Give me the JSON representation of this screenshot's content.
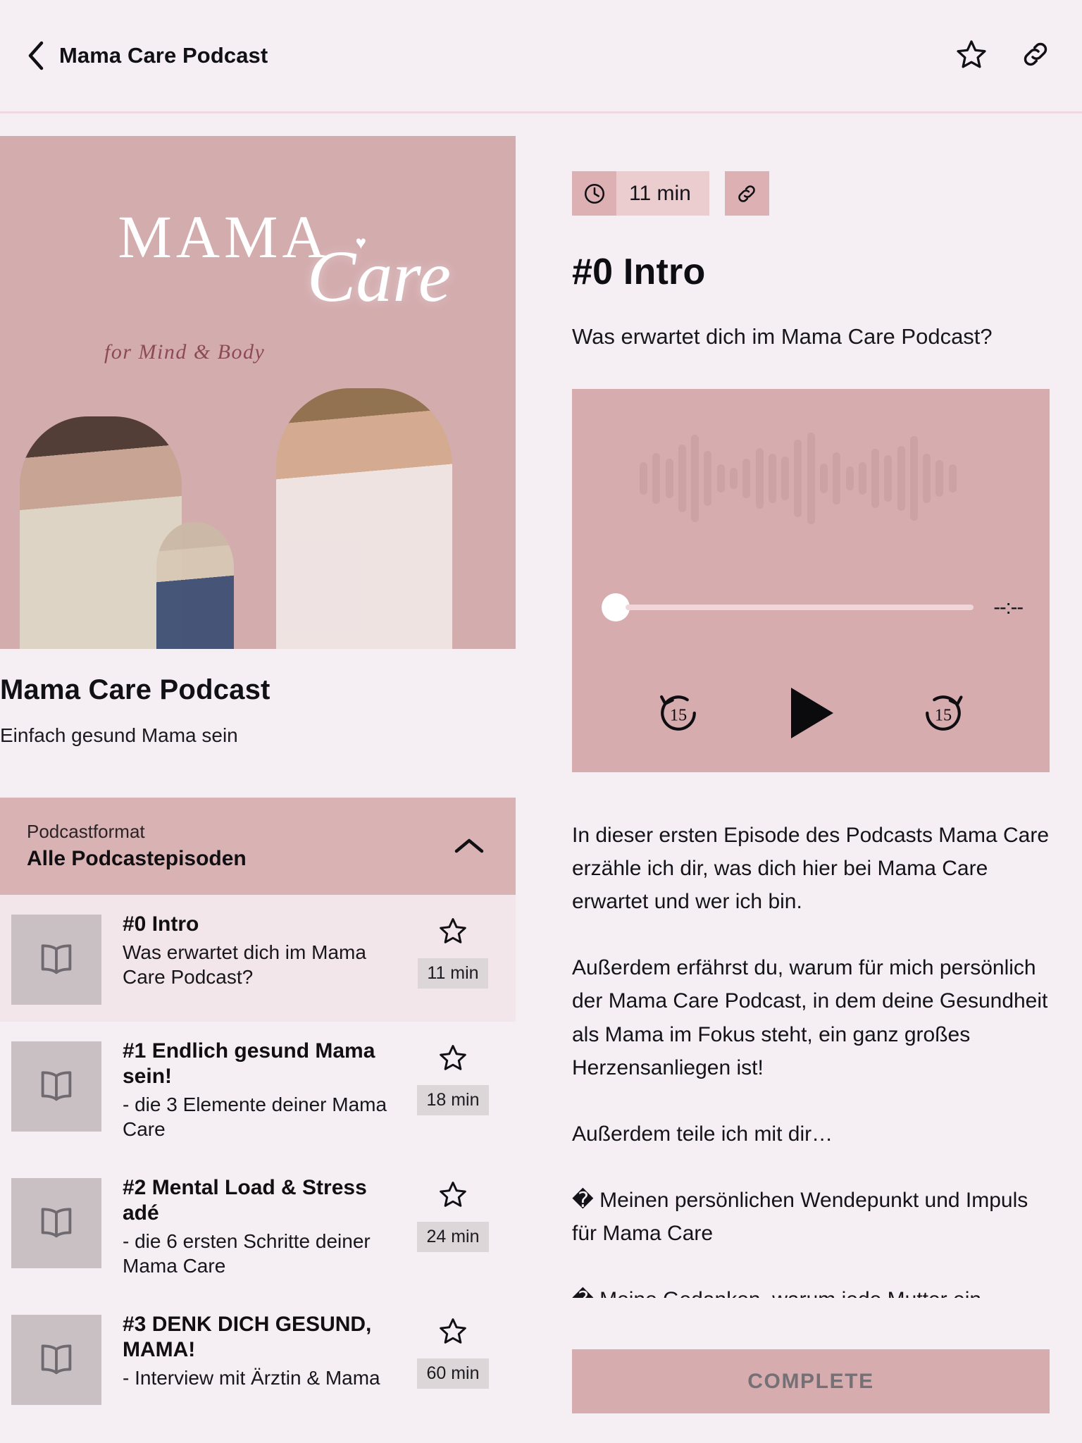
{
  "header": {
    "title": "Mama Care Podcast",
    "back_icon": "chevron-left-icon",
    "favorite_icon": "star-outline-icon",
    "share_icon": "link-icon"
  },
  "cover": {
    "brand_main": "MAMA",
    "brand_script": "Care",
    "brand_tagline": "for Mind & Body",
    "heart": "♥"
  },
  "podcast": {
    "title": "Mama Care Podcast",
    "subtitle": "Einfach gesund Mama sein"
  },
  "format_selector": {
    "label": "Podcastformat",
    "value": "Alle Podcastepisoden",
    "chevron_icon": "chevron-up-icon"
  },
  "episodes": [
    {
      "title": "#0 Intro",
      "description": "Was erwartet dich im Mama Care Podcast?",
      "duration": "11 min",
      "icon": "book-icon",
      "favorite_icon": "star-outline-icon",
      "active": true
    },
    {
      "title": "#1 Endlich gesund Mama sein!",
      "description": "- die 3 Elemente deiner Mama Care",
      "duration": "18 min",
      "icon": "book-icon",
      "favorite_icon": "star-outline-icon",
      "active": false
    },
    {
      "title": "#2 Mental Load & Stress adé",
      "description": "- die 6 ersten Schritte deiner Mama Care",
      "duration": "24 min",
      "icon": "book-icon",
      "favorite_icon": "star-outline-icon",
      "active": false
    },
    {
      "title": "#3 DENK DICH GESUND, MAMA!",
      "description": "- Interview mit Ärztin & Mama",
      "duration": "60 min",
      "icon": "book-icon",
      "favorite_icon": "star-outline-icon",
      "active": false
    }
  ],
  "detail": {
    "duration_badge": "11 min",
    "clock_icon": "clock-icon",
    "link_icon": "link-icon",
    "heading": "#0 Intro",
    "subtitle": "Was erwartet dich im Mama Care Podcast?",
    "description": "In dieser ersten Episode des Podcasts Mama Care erzähle ich dir, was dich hier bei Mama Care erwartet und wer ich bin.\n\nAußerdem erfährst du, warum für mich persönlich der Mama Care Podcast, in dem deine Gesundheit als Mama im Fokus steht, ein ganz großes Herzensanliegen ist!\n\nAußerdem teile ich mit dir…\n\n� Meinen persönlichen Wendepunkt und Impuls für Mama Care\n\n� Meine Gedanken, warum jede Mutter ein effektives Gesundheits- und Stressmanagement braucht",
    "complete_label": "COMPLETE"
  },
  "player": {
    "current_time": "--:--",
    "progress_percent": 0,
    "rewind_label": "15",
    "forward_label": "15",
    "rewind_icon": "rewind-15-icon",
    "play_icon": "play-icon",
    "forward_icon": "forward-15-icon",
    "seek_handle_icon": "seek-handle-icon"
  },
  "colors": {
    "page_bg": "#F5EEF2",
    "rose": "#D6ACAE",
    "rose_dark": "#D9B2B4",
    "chip_light": "#EBCCCF",
    "chip_dark": "#DDB1B4",
    "text": "#111014",
    "muted": "#757075"
  },
  "waveform_bars": [
    46,
    72,
    56,
    96,
    124,
    78,
    40,
    30,
    56,
    86,
    70,
    62,
    110,
    130,
    42,
    74,
    34,
    46,
    84,
    66,
    92,
    120,
    70,
    52,
    40
  ]
}
